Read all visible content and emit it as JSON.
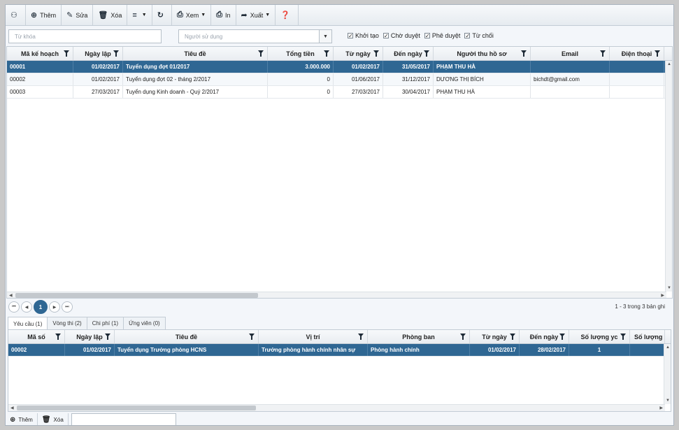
{
  "toolbar": {
    "find_icon": "binoculars-icon",
    "add": "Thêm",
    "edit": "Sửa",
    "delete": "Xóa",
    "view": "Xem",
    "print": "In",
    "export": "Xuất"
  },
  "filters": {
    "keyword_placeholder": "Từ khóa",
    "user_placeholder": "Người sử dụng",
    "statuses": [
      {
        "label": "Khởi tạo",
        "checked": true
      },
      {
        "label": "Chờ duyệt",
        "checked": true
      },
      {
        "label": "Phê duyệt",
        "checked": true
      },
      {
        "label": "Từ chối",
        "checked": true
      }
    ]
  },
  "main_grid": {
    "columns": [
      "Mã kế hoạch",
      "Ngày lập",
      "Tiêu đề",
      "Tổng tiền",
      "Từ ngày",
      "Đến ngày",
      "Người thu hồ sơ",
      "Email",
      "Điện thoại"
    ],
    "rows": [
      [
        "00001",
        "01/02/2017",
        "Tuyển dụng đợt 01/2017",
        "3.000.000",
        "01/02/2017",
        "31/05/2017",
        "PHẠM THU HÀ",
        "",
        ""
      ],
      [
        "00002",
        "01/02/2017",
        "Tuyển dụng đợt 02 - tháng 2/2017",
        "0",
        "01/06/2017",
        "31/12/2017",
        "DƯƠNG THỊ BÍCH",
        "bichdt@gmail.com",
        ""
      ],
      [
        "00003",
        "27/03/2017",
        "Tuyển dụng Kinh doanh - Quý 2/2017",
        "0",
        "27/03/2017",
        "30/04/2017",
        "PHẠM THU HÀ",
        "",
        ""
      ]
    ],
    "selected_row": 0
  },
  "pager": {
    "current_page": "1",
    "info": "1 - 3 trong 3 bản ghi"
  },
  "tabs": [
    "Yêu cầu (1)",
    "Vòng thi (2)",
    "Chi phí (1)",
    "Ứng viên (0)"
  ],
  "detail_grid": {
    "columns": [
      "Mã số",
      "Ngày lập",
      "Tiêu đề",
      "Vị trí",
      "Phòng ban",
      "Từ ngày",
      "Đến ngày",
      "Số lượng yc",
      "Số lượng"
    ],
    "rows": [
      [
        "00002",
        "01/02/2017",
        "Tuyển dụng Trưởng phòng HCNS",
        "Trưởng phòng hành chính nhân sự",
        "Phòng hành chính",
        "01/02/2017",
        "28/02/2017",
        "1",
        ""
      ]
    ]
  },
  "bottombar": {
    "add": "Thêm",
    "delete": "Xóa"
  }
}
